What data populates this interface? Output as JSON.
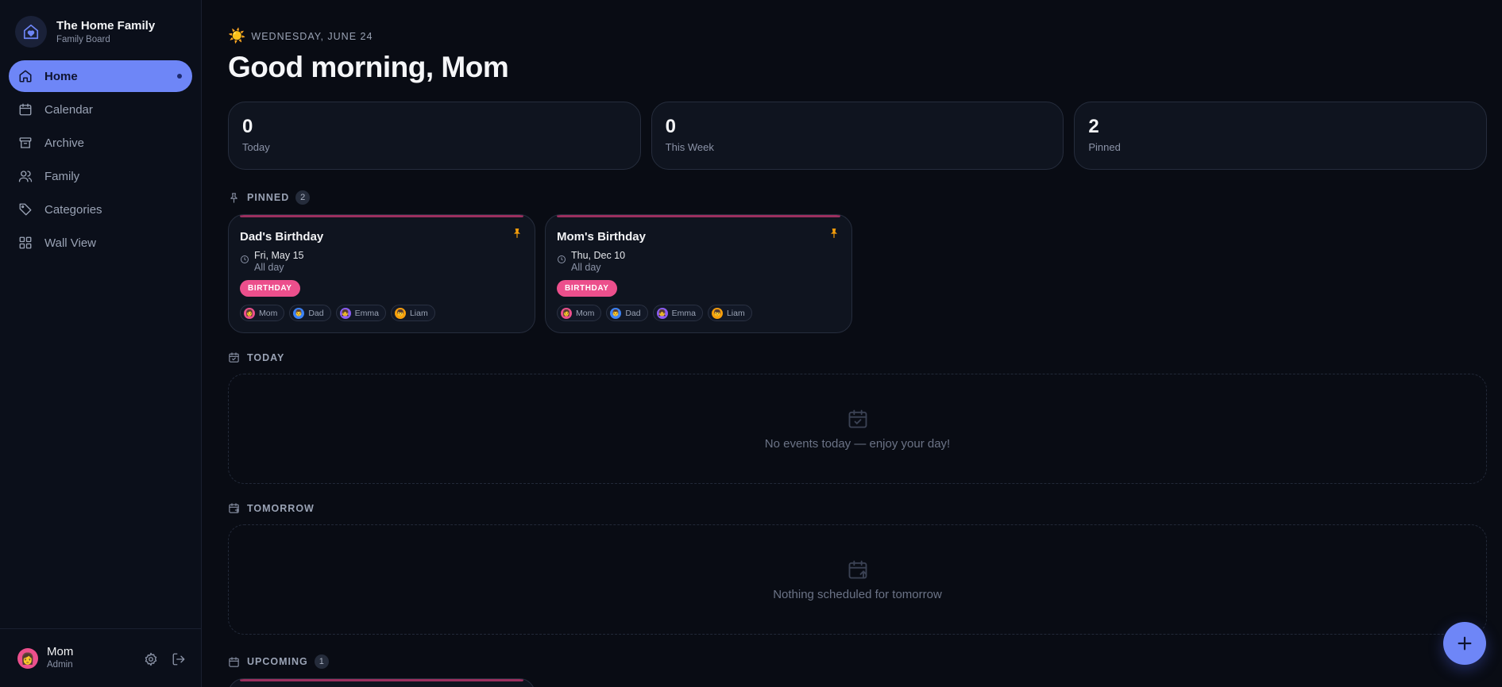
{
  "brand": {
    "name": "The Home Family",
    "subtitle": "Family Board",
    "icon": "house-heart-icon"
  },
  "nav": [
    {
      "label": "Home",
      "icon": "home-icon",
      "active": true
    },
    {
      "label": "Calendar",
      "icon": "calendar-icon"
    },
    {
      "label": "Archive",
      "icon": "archive-icon"
    },
    {
      "label": "Family",
      "icon": "users-icon"
    },
    {
      "label": "Categories",
      "icon": "tag-icon"
    },
    {
      "label": "Wall View",
      "icon": "grid-icon"
    }
  ],
  "user": {
    "name": "Mom",
    "role": "Admin",
    "avatar": "👩"
  },
  "header": {
    "date": "WEDNESDAY, JUNE 24",
    "greeting": "Good morning, Mom"
  },
  "stats": [
    {
      "value": "0",
      "label": "Today"
    },
    {
      "value": "0",
      "label": "This Week"
    },
    {
      "value": "2",
      "label": "Pinned"
    }
  ],
  "pinned": {
    "title": "PINNED",
    "count": "2",
    "cards": [
      {
        "title": "Dad's Birthday",
        "date": "Fri, May 15",
        "time": "All day",
        "tag": "BIRTHDAY",
        "people": [
          {
            "name": "Mom",
            "avatar": "👩",
            "color": "#ec4f8c"
          },
          {
            "name": "Dad",
            "avatar": "👨",
            "color": "#3b82f6"
          },
          {
            "name": "Emma",
            "avatar": "👧",
            "color": "#8b5cf6"
          },
          {
            "name": "Liam",
            "avatar": "👦",
            "color": "#f59e0b"
          }
        ]
      },
      {
        "title": "Mom's Birthday",
        "date": "Thu, Dec 10",
        "time": "All day",
        "tag": "BIRTHDAY",
        "people": [
          {
            "name": "Mom",
            "avatar": "👩",
            "color": "#ec4f8c"
          },
          {
            "name": "Dad",
            "avatar": "👨",
            "color": "#3b82f6"
          },
          {
            "name": "Emma",
            "avatar": "👧",
            "color": "#8b5cf6"
          },
          {
            "name": "Liam",
            "avatar": "👦",
            "color": "#f59e0b"
          }
        ]
      }
    ]
  },
  "today": {
    "title": "TODAY",
    "empty": "No events today — enjoy your day!"
  },
  "tomorrow": {
    "title": "TOMORROW",
    "empty": "Nothing scheduled for tomorrow"
  },
  "upcoming": {
    "title": "UPCOMING",
    "count": "1"
  },
  "colors": {
    "accent": "#6e86f7",
    "birthday": "#ec4f8c",
    "pin": "#f59e0b",
    "background": "#090c14"
  }
}
